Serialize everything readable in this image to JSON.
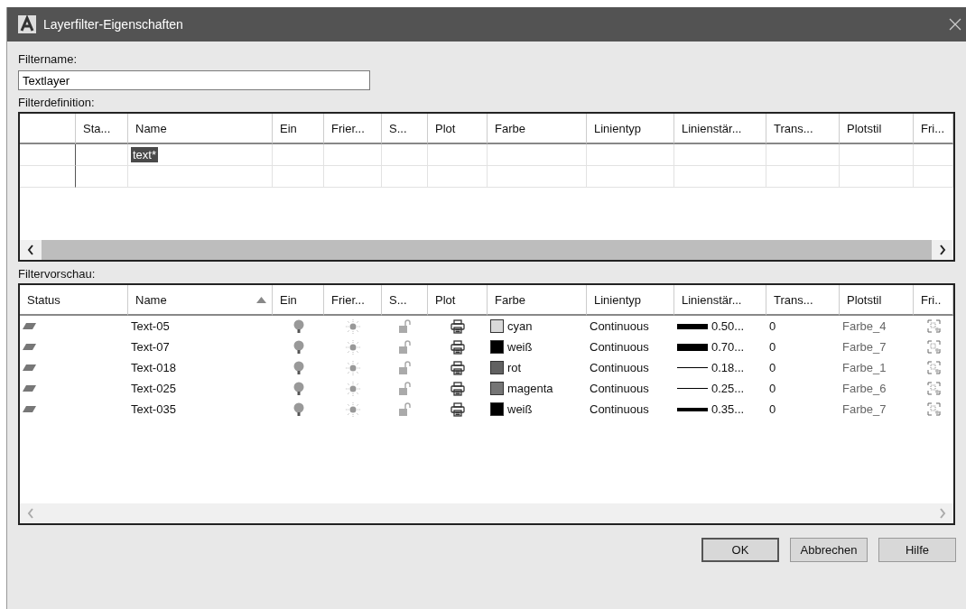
{
  "window": {
    "title": "Layerfilter-Eigenschaften"
  },
  "filter_name": {
    "label": "Filtername:",
    "value": "Textlayer"
  },
  "definition": {
    "label": "Filterdefinition:",
    "columns": [
      "Sta...",
      "Name",
      "Ein",
      "Frier...",
      "S...",
      "Plot",
      "Farbe",
      "Linientyp",
      "Linienstär...",
      "Trans...",
      "Plotstil",
      "Fri..."
    ],
    "rows": [
      {
        "name": "text*",
        "selected": true
      }
    ]
  },
  "preview": {
    "label": "Filtervorschau:",
    "columns": [
      {
        "label": "Status",
        "sorted": false
      },
      {
        "label": "Name",
        "sorted": true
      },
      {
        "label": "Ein",
        "sorted": false
      },
      {
        "label": "Frier...",
        "sorted": false
      },
      {
        "label": "S...",
        "sorted": false
      },
      {
        "label": "Plot",
        "sorted": false
      },
      {
        "label": "Farbe",
        "sorted": false
      },
      {
        "label": "Linientyp",
        "sorted": false
      },
      {
        "label": "Linienstär...",
        "sorted": false
      },
      {
        "label": "Trans...",
        "sorted": false
      },
      {
        "label": "Plotstil",
        "sorted": false
      },
      {
        "label": "Fri..",
        "sorted": false
      }
    ],
    "rows": [
      {
        "name": "Text-05",
        "color_name": "cyan",
        "color": "#d9d9d9",
        "linetype": "Continuous",
        "kind": "heavy",
        "lineweight": "0.50...",
        "transparency": "0",
        "plotstyle": "Farbe_4"
      },
      {
        "name": "Text-07",
        "color_name": "weiß",
        "color": "#000000",
        "linetype": "Continuous",
        "kind": "heaviest",
        "lineweight": "0.70...",
        "transparency": "0",
        "plotstyle": "Farbe_7"
      },
      {
        "name": "Text-018",
        "color_name": "rot",
        "color": "#616161",
        "linetype": "Continuous",
        "kind": "thin",
        "lineweight": "0.18...",
        "transparency": "0",
        "plotstyle": "Farbe_1"
      },
      {
        "name": "Text-025",
        "color_name": "magenta",
        "color": "#757575",
        "linetype": "Continuous",
        "kind": "thin",
        "lineweight": "0.25...",
        "transparency": "0",
        "plotstyle": "Farbe_6"
      },
      {
        "name": "Text-035",
        "color_name": "weiß",
        "color": "#000000",
        "linetype": "Continuous",
        "kind": "medium",
        "lineweight": "0.35...",
        "transparency": "0",
        "plotstyle": "Farbe_7"
      }
    ]
  },
  "buttons": [
    {
      "label": "OK",
      "default": true
    },
    {
      "label": "Abbrechen",
      "default": false
    },
    {
      "label": "Hilfe",
      "default": false
    }
  ]
}
